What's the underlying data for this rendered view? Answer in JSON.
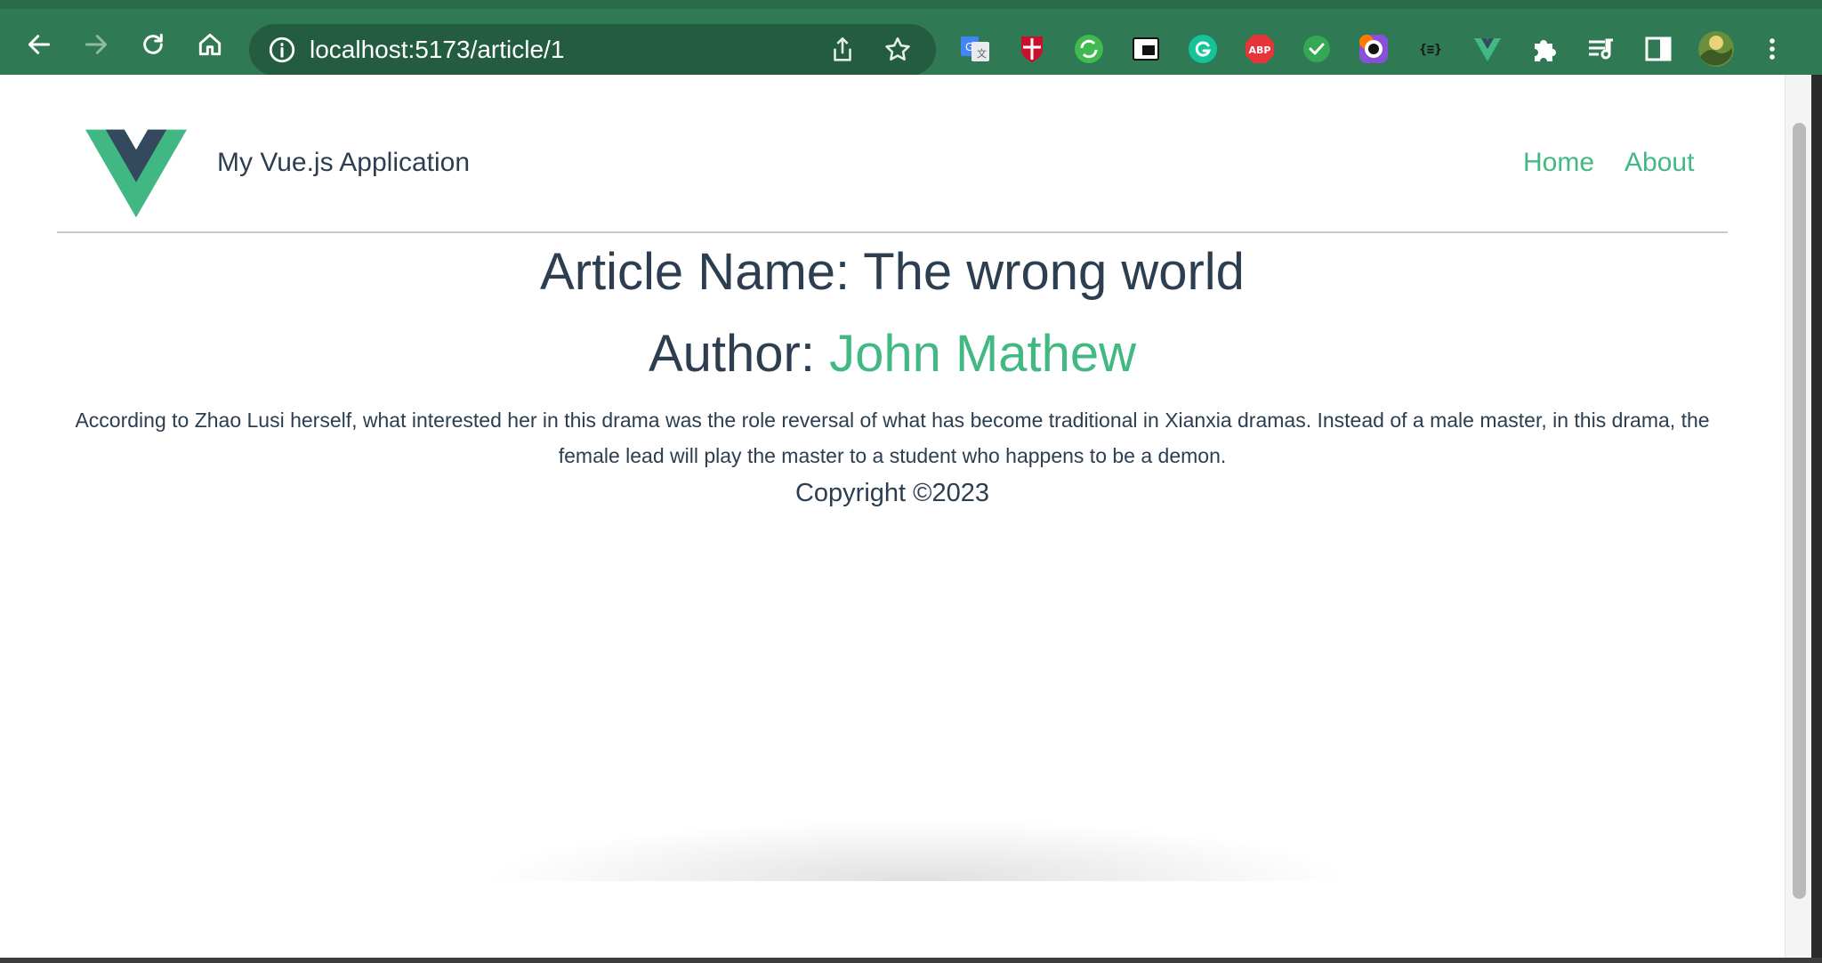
{
  "browser": {
    "url": "localhost:5173/article/1",
    "toolbar_color": "#2f7a55",
    "icons": [
      "back-icon",
      "forward-icon",
      "reload-icon",
      "home-icon",
      "info-icon",
      "share-icon",
      "star-icon"
    ],
    "extensions": [
      "google-translate-icon",
      "shield-crest-icon",
      "sync-icon",
      "picture-in-picture-icon",
      "grammarly-icon",
      "adblock-icon",
      "checkmark-icon",
      "lens-icon",
      "json-viewer-icon",
      "vue-devtools-icon",
      "extensions-puzzle-icon",
      "media-queue-icon",
      "side-panel-icon",
      "profile-avatar",
      "more-menu-icon"
    ],
    "adblock_label": "ABP",
    "json_label": "{≡}"
  },
  "header": {
    "logo": "vue-logo",
    "title": "My Vue.js Application",
    "nav": {
      "home": "Home",
      "about": "About"
    }
  },
  "article": {
    "name_line": "Article Name: The wrong world",
    "author_label": "Author: ",
    "author_name": "John Mathew",
    "body": "According to Zhao Lusi herself, what interested her in this drama was the role reversal of what has become traditional in Xianxia dramas. Instead of a male master, in this drama, the female lead will play the master to a student who happens to be a demon."
  },
  "footer": {
    "copyright": "Copyright ©2023"
  },
  "colors": {
    "accent": "#42b983",
    "text": "#2c3e50",
    "vue_dark": "#34495e"
  }
}
